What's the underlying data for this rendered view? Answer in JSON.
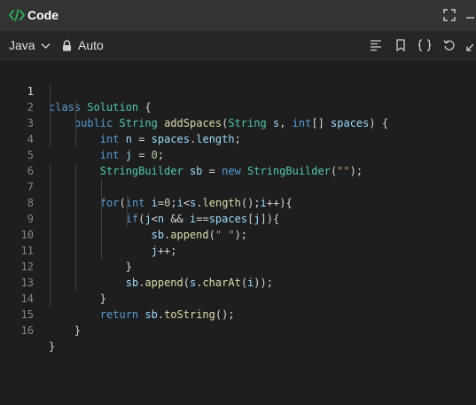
{
  "header": {
    "title": "Code",
    "icons": [
      "code-icon",
      "expand-icon",
      "minimize-icon"
    ]
  },
  "toolbar": {
    "language": "Java",
    "mode": "Auto",
    "icons": [
      "lock-icon",
      "format-icon",
      "bookmark-icon",
      "braces-icon",
      "reset-icon",
      "fullscreen-icon"
    ]
  },
  "editor": {
    "line_numbers": [
      "1",
      "2",
      "3",
      "4",
      "5",
      "6",
      "7",
      "8",
      "9",
      "10",
      "11",
      "12",
      "13",
      "14",
      "15",
      "16"
    ],
    "lines": [
      "class Solution {",
      "    public String addSpaces(String s, int[] spaces) {",
      "        int n = spaces.length;",
      "        int j = 0;",
      "        StringBuilder sb = new StringBuilder(\"\");",
      "",
      "        for(int i=0;i<s.length();i++){",
      "            if(j<n && i==spaces[j]){",
      "                sb.append(\" \");",
      "                j++;",
      "            }",
      "            sb.append(s.charAt(i));",
      "        }",
      "        return sb.toString();",
      "    }",
      "}"
    ]
  },
  "colors": {
    "background": "#1e1e1e",
    "titlebar": "#333333",
    "keyword": "#569cd6",
    "type": "#4ec9b0",
    "function": "#dcdcaa",
    "variable": "#9cdcfe",
    "string": "#ce9178"
  }
}
